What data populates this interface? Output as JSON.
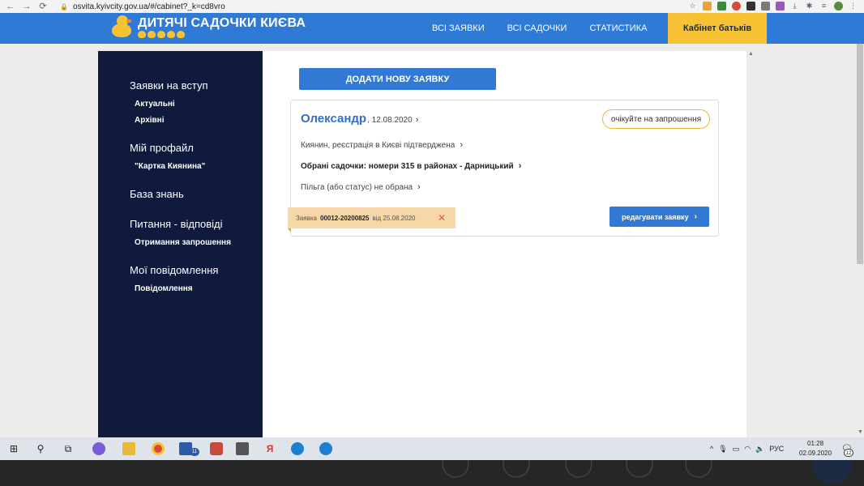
{
  "browser": {
    "back": "←",
    "forward": "→",
    "reload": "⟳",
    "url": "osvita.kyivcity.gov.ua/#/cabinet?_k=cd8vro",
    "star": "☆"
  },
  "header": {
    "logo_title": "ДИТЯЧІ САДОЧКИ КИЄВА",
    "nav": [
      "ВСІ ЗАЯВКИ",
      "ВСІ САДОЧКИ",
      "СТАТИСТИКА"
    ],
    "cabinet_label": "Кабінет батьків",
    "colors": {
      "header": "#2f7ad6",
      "cabinet": "#f7c234"
    }
  },
  "sidebar": {
    "sections": [
      {
        "title": "Заявки на вступ",
        "items": [
          "Актуальні",
          "Архівні"
        ]
      },
      {
        "title": "Мій профайл",
        "items": [
          "\"Картка Киянина\""
        ]
      },
      {
        "title": "База знань",
        "items": []
      },
      {
        "title": "Питання - відповіді",
        "items": [
          "Отримання запрошення"
        ]
      },
      {
        "title": "Мої повідомлення",
        "items": [
          "Повідомлення"
        ]
      }
    ]
  },
  "main": {
    "add_button": "ДОДАТИ НОВУ ЗАЯВКУ",
    "card": {
      "name": "Олександр",
      "date": ", 12.08.2020",
      "status": "очікуйте на запрошення",
      "row1": "Киянин, реєстрація в Києві підтверджена",
      "row2": "Обрані садочки: номери 315 в районах - Дарницький",
      "row3": "Пільга (або статус) не обрана",
      "ticket_prefix": "Заявка",
      "ticket_number": "00012-20200825",
      "ticket_suffix": "від 25.08.2020",
      "ticket_close": "✕",
      "edit_button": "редагувати заявку"
    }
  },
  "taskbar": {
    "badge_mail": "11",
    "tray_lang": "РУС",
    "time": "01:28",
    "date": "02.09.2020",
    "notif_count": "12"
  }
}
